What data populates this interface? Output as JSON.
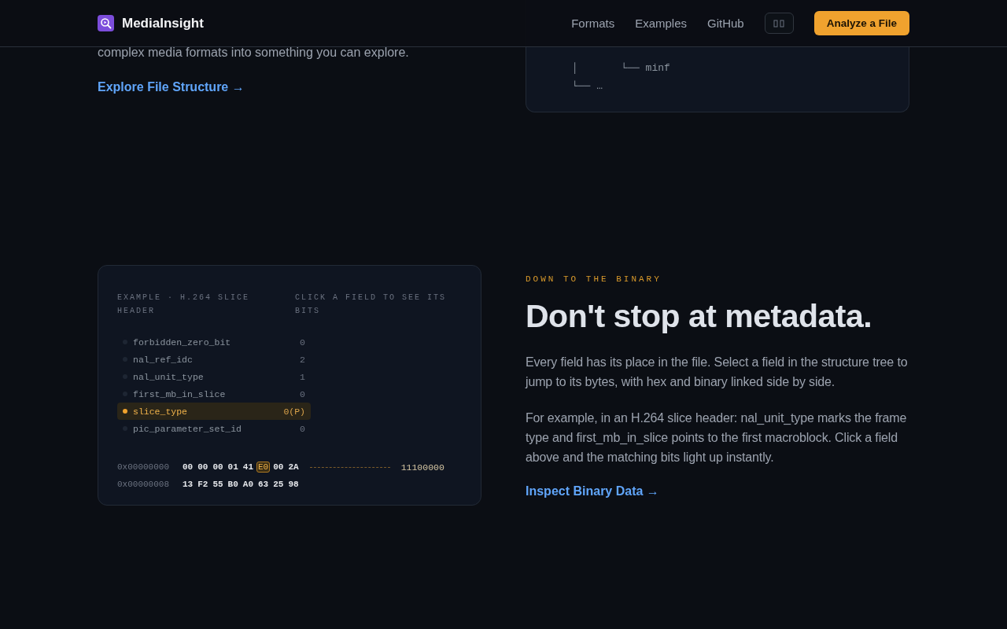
{
  "header": {
    "brand": "MediaInsight",
    "nav": [
      "Formats",
      "Examples",
      "GitHub"
    ],
    "cta": "Analyze a File"
  },
  "intro": {
    "text_tail": "complex media formats into something you can explore.",
    "link": "Explore File Structure →",
    "tree_lines": [
      "│       └── minf",
      "└── …"
    ]
  },
  "example": {
    "title": "EXAMPLE · H.264 SLICE HEADER",
    "hint": "CLICK A FIELD TO SEE ITS BITS",
    "fields": [
      {
        "name": "forbidden_zero_bit",
        "value": "0",
        "selected": false
      },
      {
        "name": "nal_ref_idc",
        "value": "2",
        "selected": false
      },
      {
        "name": "nal_unit_type",
        "value": "1",
        "selected": false
      },
      {
        "name": "first_mb_in_slice",
        "value": "0",
        "selected": false
      },
      {
        "name": "slice_type",
        "value": "0(P)",
        "selected": true
      },
      {
        "name": "pic_parameter_set_id",
        "value": "0",
        "selected": false
      }
    ],
    "hex_rows": [
      {
        "offset": "0x00000000",
        "bytes": [
          {
            "text": "00",
            "selected": false
          },
          {
            "text": "00",
            "selected": false
          },
          {
            "text": "00",
            "selected": false
          },
          {
            "text": "01",
            "selected": false
          },
          {
            "text": "41",
            "selected": false
          },
          {
            "text": "E0",
            "selected": true
          },
          {
            "text": "00",
            "selected": false
          },
          {
            "text": "2A",
            "selected": false
          }
        ],
        "binary": "11100000"
      },
      {
        "offset": "0x00000008",
        "bytes": [
          {
            "text": "13",
            "selected": false
          },
          {
            "text": "F2",
            "selected": false
          },
          {
            "text": "55",
            "selected": false
          },
          {
            "text": "B0",
            "selected": false
          },
          {
            "text": "A0",
            "selected": false
          },
          {
            "text": "63",
            "selected": false
          },
          {
            "text": "25",
            "selected": false
          },
          {
            "text": "98",
            "selected": false
          }
        ]
      }
    ]
  },
  "binary_section": {
    "eyebrow": "DOWN TO THE BINARY",
    "heading": "Don't stop at metadata.",
    "paragraphs": [
      "Every field has its place in the file. Select a field in the structure tree to jump to its bytes, with hex and binary linked side by side.",
      "For example, in an H.264 slice header: nal_unit_type marks the frame type and first_mb_in_slice points to the first macroblock. Click a field above and the matching bits light up instantly."
    ],
    "link": "Inspect Binary Data →"
  }
}
